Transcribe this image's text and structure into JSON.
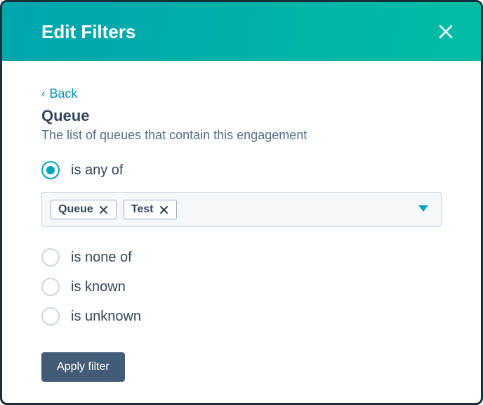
{
  "header": {
    "title": "Edit Filters"
  },
  "back": {
    "label": "Back"
  },
  "filter": {
    "name": "Queue",
    "description": "The list of queues that contain this engagement"
  },
  "options": {
    "is_any_of": "is any of",
    "is_none_of": "is none of",
    "is_known": "is known",
    "is_unknown": "is unknown",
    "selected": "is_any_of"
  },
  "chips": [
    {
      "label": "Queue"
    },
    {
      "label": "Test"
    }
  ],
  "apply": {
    "label": "Apply filter"
  },
  "colors": {
    "accent": "#00a4bd",
    "header_gradient_start": "#00a5ad",
    "header_gradient_end": "#00bda5",
    "button_bg": "#425b76"
  }
}
